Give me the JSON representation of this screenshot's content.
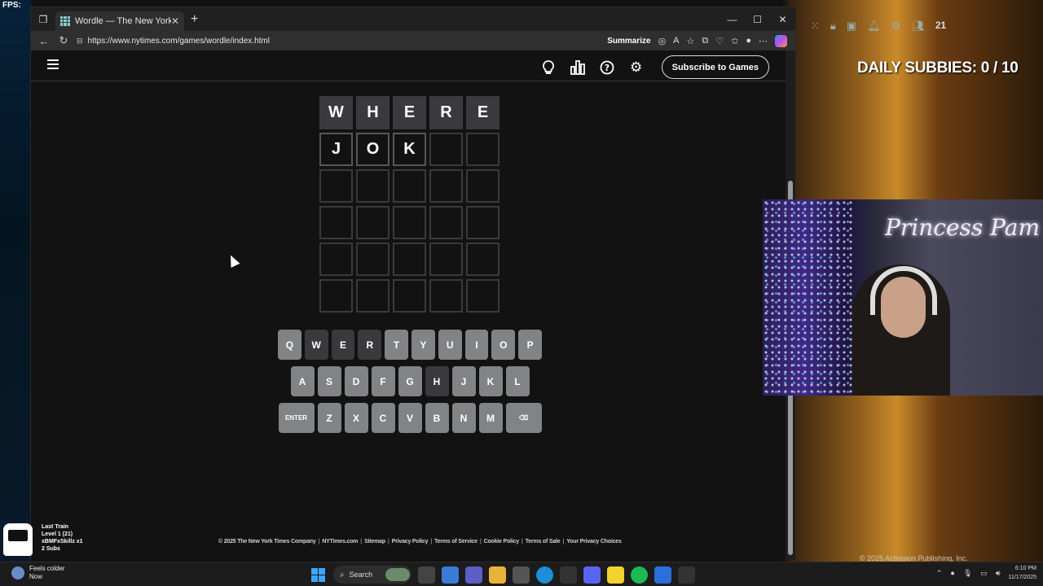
{
  "stream": {
    "fps_label": "FPS:",
    "subbies": "DAILY SUBBIES:  0 / 10",
    "overlay_count": "21",
    "webcam_sign": "Princess Pam",
    "activision": "© 2025 Activision Publishing, Inc.",
    "widget": {
      "line1": "Last Train",
      "line2": "Level 1  (21)",
      "line3": "xBMFxSkillz x1",
      "line4": "2 Subs"
    }
  },
  "browser": {
    "tab_title": "Wordle — The New York Times",
    "url": "https://www.nytimes.com/games/wordle/index.html",
    "summarize": "Summarize"
  },
  "wordle": {
    "subscribe_label": "Subscribe to Games",
    "rows": [
      [
        "W",
        "H",
        "E",
        "R",
        "E"
      ],
      [
        "J",
        "O",
        "K",
        "",
        ""
      ],
      [
        "",
        "",
        "",
        "",
        ""
      ],
      [
        "",
        "",
        "",
        "",
        ""
      ],
      [
        "",
        "",
        "",
        "",
        ""
      ],
      [
        "",
        "",
        "",
        "",
        ""
      ]
    ],
    "keyboard": {
      "row1": [
        "Q",
        "W",
        "E",
        "R",
        "T",
        "Y",
        "U",
        "I",
        "O",
        "P"
      ],
      "row2": [
        "A",
        "S",
        "D",
        "F",
        "G",
        "H",
        "J",
        "K",
        "L"
      ],
      "row3": [
        "ENTER",
        "Z",
        "X",
        "C",
        "V",
        "B",
        "N",
        "M",
        "⌫"
      ]
    },
    "used_keys": [
      "W",
      "E",
      "R",
      "H"
    ],
    "footer": [
      "© 2025 The New York Times Company",
      "NYTimes.com",
      "Sitemap",
      "Privacy Policy",
      "Terms of Service",
      "Cookie Policy",
      "Terms of Sale",
      "Your Privacy Choices"
    ]
  },
  "taskbar": {
    "weather_title": "Feels colder",
    "weather_sub": "Now",
    "search_label": "Search",
    "time": "6:10 PM",
    "date": "11/17/2025"
  },
  "colors": {
    "absent": "#3a3a3c",
    "key": "#818384",
    "background": "#121213"
  }
}
